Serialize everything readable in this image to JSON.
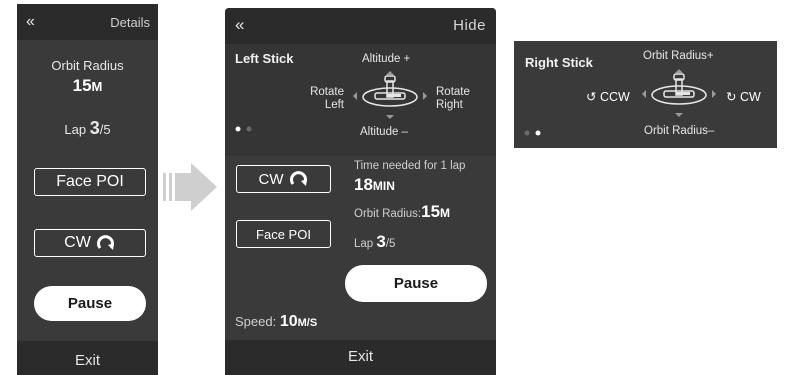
{
  "panel_compact": {
    "back_glyph": "«",
    "details_label": "Details",
    "orbit_radius_label": "Orbit Radius",
    "orbit_radius_value": "15",
    "orbit_radius_unit": "M",
    "lap_label": "Lap",
    "lap_current": "3",
    "lap_total": "/5",
    "face_poi_label": "Face POI",
    "direction_label": "CW",
    "pause_label": "Pause",
    "exit_label": "Exit"
  },
  "panel_expanded": {
    "back_glyph": "«",
    "hide_label": "Hide",
    "left_stick_label": "Left Stick",
    "altitude_up_label": "Altitude +",
    "altitude_down_label": "Altitude –",
    "rotate_left_label": "Rotate Left",
    "rotate_right_label": "Rotate Right",
    "direction_label": "CW",
    "face_poi_label": "Face POI",
    "time_needed_label": "Time needed for 1 lap",
    "time_needed_value": "18",
    "time_needed_unit": "MIN",
    "orbit_radius_label": "Orbit Radius:",
    "orbit_radius_value": "15",
    "orbit_radius_unit": "M",
    "lap_label": "Lap",
    "lap_current": "3",
    "lap_total": "/5",
    "pause_label": "Pause",
    "speed_label": "Speed:",
    "speed_value": "10",
    "speed_unit": "M/S",
    "exit_label": "Exit",
    "page_dots": {
      "count": 2,
      "active": 0
    }
  },
  "panel_right_stick": {
    "right_stick_label": "Right Stick",
    "orbit_radius_up_label": "Orbit Radius+",
    "orbit_radius_down_label": "Orbit Radius–",
    "ccw_label": "CCW",
    "cw_label": "CW",
    "page_dots": {
      "count": 2,
      "active": 1
    }
  },
  "colors": {
    "panel_bg": "#3a3a3a",
    "header_bg": "#2b2b2b",
    "text": "#ffffff",
    "button_fill": "#ffffff"
  }
}
